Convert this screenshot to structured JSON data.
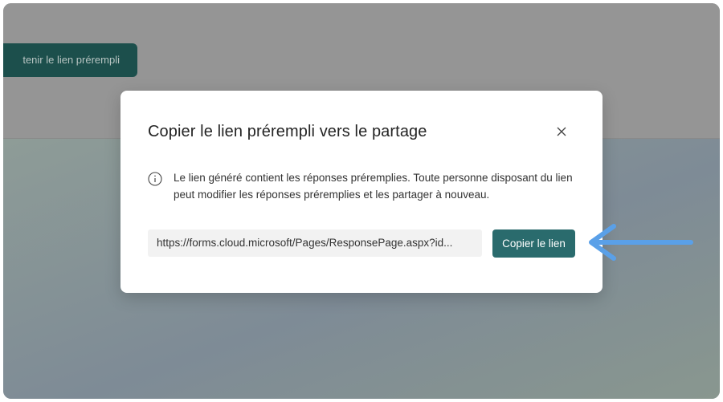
{
  "background": {
    "prefill_button_label": "tenir le lien prérempli"
  },
  "dialog": {
    "title": "Copier le lien prérempli vers le partage",
    "info_text": "Le lien généré contient les réponses préremplies. Toute personne disposant du lien peut modifier les réponses préremplies et les partager à nouveau.",
    "link_value": "https://forms.cloud.microsoft/Pages/ResponsePage.aspx?id...",
    "copy_button_label": "Copier le lien",
    "close_icon": "close-icon",
    "info_icon": "info-icon"
  },
  "annotation": {
    "arrow_icon": "arrow-left-icon",
    "arrow_color": "#5aa0e8"
  },
  "colors": {
    "accent": "#2a6b6d",
    "dark_button": "#1c4f4c"
  }
}
